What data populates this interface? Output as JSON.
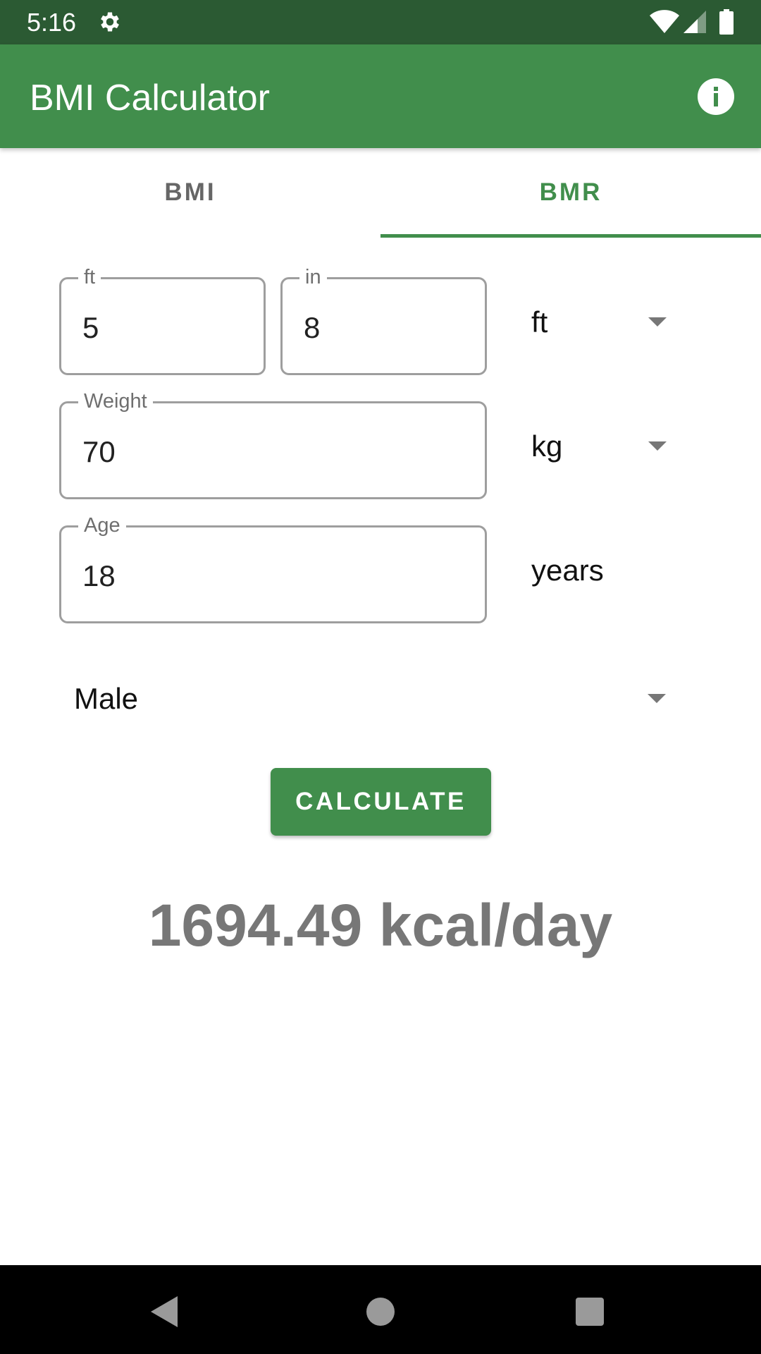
{
  "status_bar": {
    "time": "5:16",
    "icons": [
      "gear-icon",
      "wifi-icon",
      "cell-signal-icon",
      "battery-icon"
    ]
  },
  "app_bar": {
    "title": "BMI Calculator",
    "action_icon": "info-icon"
  },
  "tabs": [
    {
      "label": "BMI",
      "selected": false
    },
    {
      "label": "BMR",
      "selected": true
    }
  ],
  "form": {
    "height_ft": {
      "label": "ft",
      "value": "5"
    },
    "height_in": {
      "label": "in",
      "value": "8"
    },
    "height_unit": {
      "selected": "ft"
    },
    "weight": {
      "label": "Weight",
      "value": "70"
    },
    "weight_unit": {
      "selected": "kg"
    },
    "age": {
      "label": "Age",
      "value": "18"
    },
    "age_unit": "years",
    "gender": {
      "selected": "Male"
    }
  },
  "calculate_label": "CALCULATE",
  "result": "1694.49 kcal/day",
  "colors": {
    "primary": "#418e4c",
    "primary_dark": "#2b5a33",
    "result_text": "#777777",
    "outline": "#9e9e9e"
  },
  "nav_bar": {
    "icons": [
      "back-icon",
      "home-icon",
      "recents-icon"
    ]
  }
}
